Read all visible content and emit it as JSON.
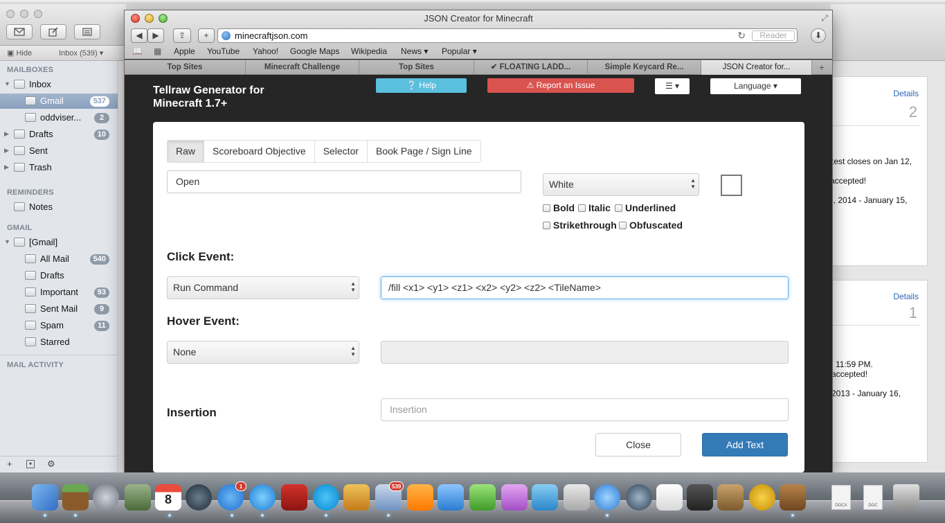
{
  "safari": {
    "window_title": "JSON Creator for Minecraft",
    "url": "minecraftjson.com",
    "reader_label": "Reader",
    "bookmarks": [
      "Apple",
      "YouTube",
      "Yahoo!",
      "Google Maps",
      "Wikipedia",
      "News ▾",
      "Popular ▾"
    ],
    "tabs": [
      "Top Sites",
      "Minecraft Challenge",
      "Top Sites",
      "✔ FLOATING LADD...",
      "Simple Keycard Re...",
      "JSON Creator for..."
    ],
    "active_tab_index": 5
  },
  "page": {
    "title": "Tellraw Generator for Minecraft 1.7+",
    "help_label": "❔ Help",
    "report_label": "⚠ Report an Issue",
    "menu_label": "☰ ▾",
    "language_label": "Language ▾",
    "modal": {
      "tabs": [
        "Raw",
        "Scoreboard Objective",
        "Selector",
        "Book Page / Sign Line"
      ],
      "active_tab": "Raw",
      "text_value": "Open",
      "color_value": "White",
      "format_options": [
        "Bold",
        "Italic",
        "Underlined",
        "Strikethrough",
        "Obfuscated"
      ],
      "click_event_label": "Click Event:",
      "click_event_value": "Run Command",
      "click_event_command": "/fill <x1> <y1> <z1> <x2> <y2> <z2> <TileName>",
      "hover_event_label": "Hover Event:",
      "hover_event_value": "None",
      "insertion_label": "Insertion",
      "insertion_placeholder": "Insertion",
      "close_label": "Close",
      "add_text_label": "Add Text"
    }
  },
  "mail": {
    "hide_label": "Hide",
    "inbox_filter": "Inbox (539) ▾",
    "sections": {
      "mailboxes": "MAILBOXES",
      "reminders": "REMINDERS",
      "gmail": "GMAIL",
      "mail_activity": "MAIL ACTIVITY"
    },
    "items": [
      {
        "label": "Inbox",
        "badge": ""
      },
      {
        "label": "Gmail",
        "badge": "537"
      },
      {
        "label": "oddviser...",
        "badge": "2"
      },
      {
        "label": "Drafts",
        "badge": "10"
      },
      {
        "label": "Sent",
        "badge": ""
      },
      {
        "label": "Trash",
        "badge": ""
      },
      {
        "label": "Notes",
        "badge": ""
      },
      {
        "label": "[Gmail]",
        "badge": ""
      },
      {
        "label": "All Mail",
        "badge": "540"
      },
      {
        "label": "Drafts",
        "badge": ""
      },
      {
        "label": "Important",
        "badge": "93"
      },
      {
        "label": "Sent Mail",
        "badge": "9"
      },
      {
        "label": "Spam",
        "badge": "11"
      },
      {
        "label": "Starred",
        "badge": ""
      }
    ]
  },
  "background_mail": {
    "card1": {
      "details": "Details",
      "count": "2",
      "lines": [
        "test closes on Jan 12,",
        "accepted!",
        "5, 2014 - January 15,"
      ]
    },
    "card2": {
      "details": "Details",
      "count": "1",
      "lines": [
        "11:59 PM.",
        "accepted!",
        "2013 - January 16,"
      ]
    }
  },
  "dock": {
    "badges": {
      "app_store": "1",
      "mail": "539"
    },
    "docs": [
      "DOCX",
      "DOC"
    ]
  },
  "colors": {
    "help": "#5bc0de",
    "report": "#d9534f",
    "add_text": "#337ab7",
    "page_bg": "#262626"
  }
}
